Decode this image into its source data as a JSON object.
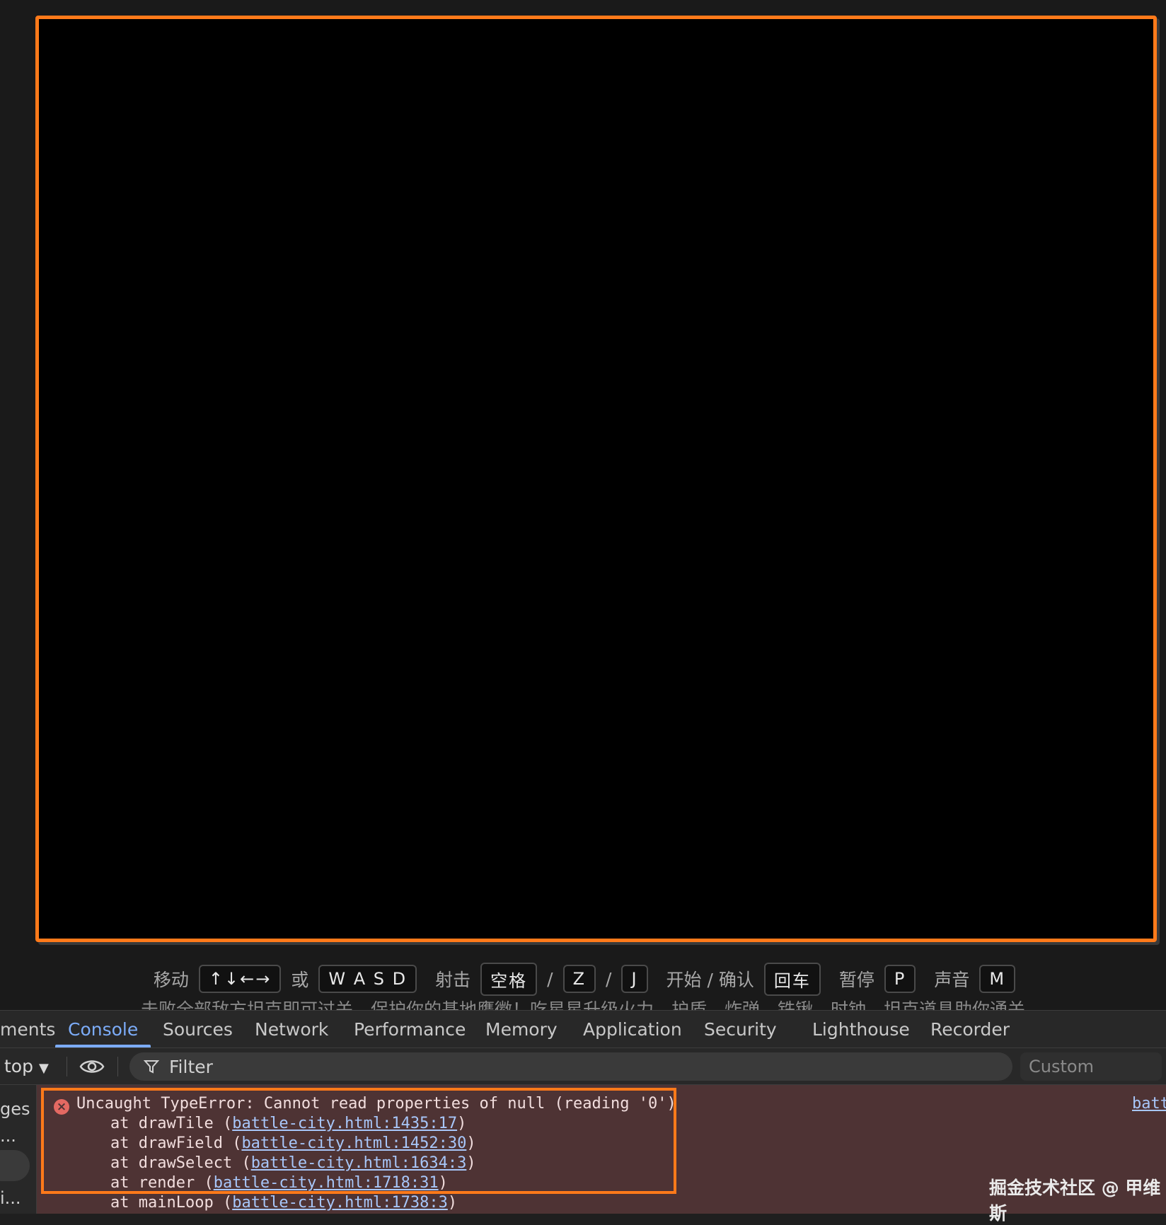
{
  "help": {
    "move_label": "移动",
    "arrows_key": "↑↓←→",
    "or_label": "或",
    "wasd_key": "W A S D",
    "shoot_label": "射击",
    "space_key": "空格",
    "slash1": "/",
    "z_key": "Z",
    "slash2": "/",
    "j_key": "J",
    "start_label": "开始 / 确认",
    "enter_key": "回车",
    "pause_label": "暂停",
    "p_key": "P",
    "sound_label": "声音",
    "m_key": "M",
    "second_line": "击败全部敌方坦克即可过关，保护你的基地鹰徽！吃星星升级火力，护盾、炸弹、铁锹、时钟，坦克道具助你通关"
  },
  "devtools": {
    "tabs": [
      "ments",
      "Console",
      "Sources",
      "Network",
      "Performance",
      "Memory",
      "Application",
      "Security",
      "Lighthouse",
      "Recorder"
    ],
    "context": "top",
    "filter_placeholder": "Filter",
    "levels": "Custom levels",
    "sidebar": {
      "line1": "ges",
      "line2": "...",
      "line3": "i..."
    },
    "error": {
      "message": "Uncaught TypeError: Cannot read properties of null (reading '0')",
      "frames": [
        {
          "fn": "at drawTile ",
          "loc": "battle-city.html:1435:17"
        },
        {
          "fn": "at drawField ",
          "loc": "battle-city.html:1452:30"
        },
        {
          "fn": "at drawSelect ",
          "loc": "battle-city.html:1634:3"
        },
        {
          "fn": "at render ",
          "loc": "battle-city.html:1718:31"
        },
        {
          "fn": "at mainLoop ",
          "loc": "battle-city.html:1738:3"
        }
      ],
      "source_link": "batt"
    },
    "watermark": "掘金技术社区 @ 甲维斯"
  },
  "colors": {
    "accent": "#ff7a1a",
    "active_tab": "#7cacf8",
    "error_bg": "#4e3334",
    "error_icon": "#e46962"
  }
}
